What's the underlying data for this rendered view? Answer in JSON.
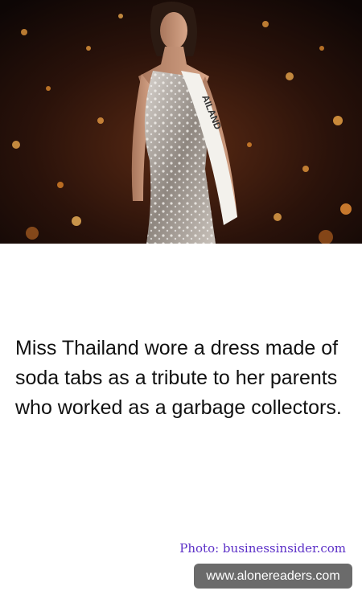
{
  "photo": {
    "subject": "pageant-contestant-photo",
    "sash_text": "AILAND"
  },
  "caption": {
    "text": "Miss Thailand wore a dress made of soda tabs as a tribute to her parents who worked as a garbage collectors."
  },
  "credit": {
    "text": "Photo: businessinsider.com"
  },
  "watermark": {
    "text": "www.alonereaders.com"
  }
}
